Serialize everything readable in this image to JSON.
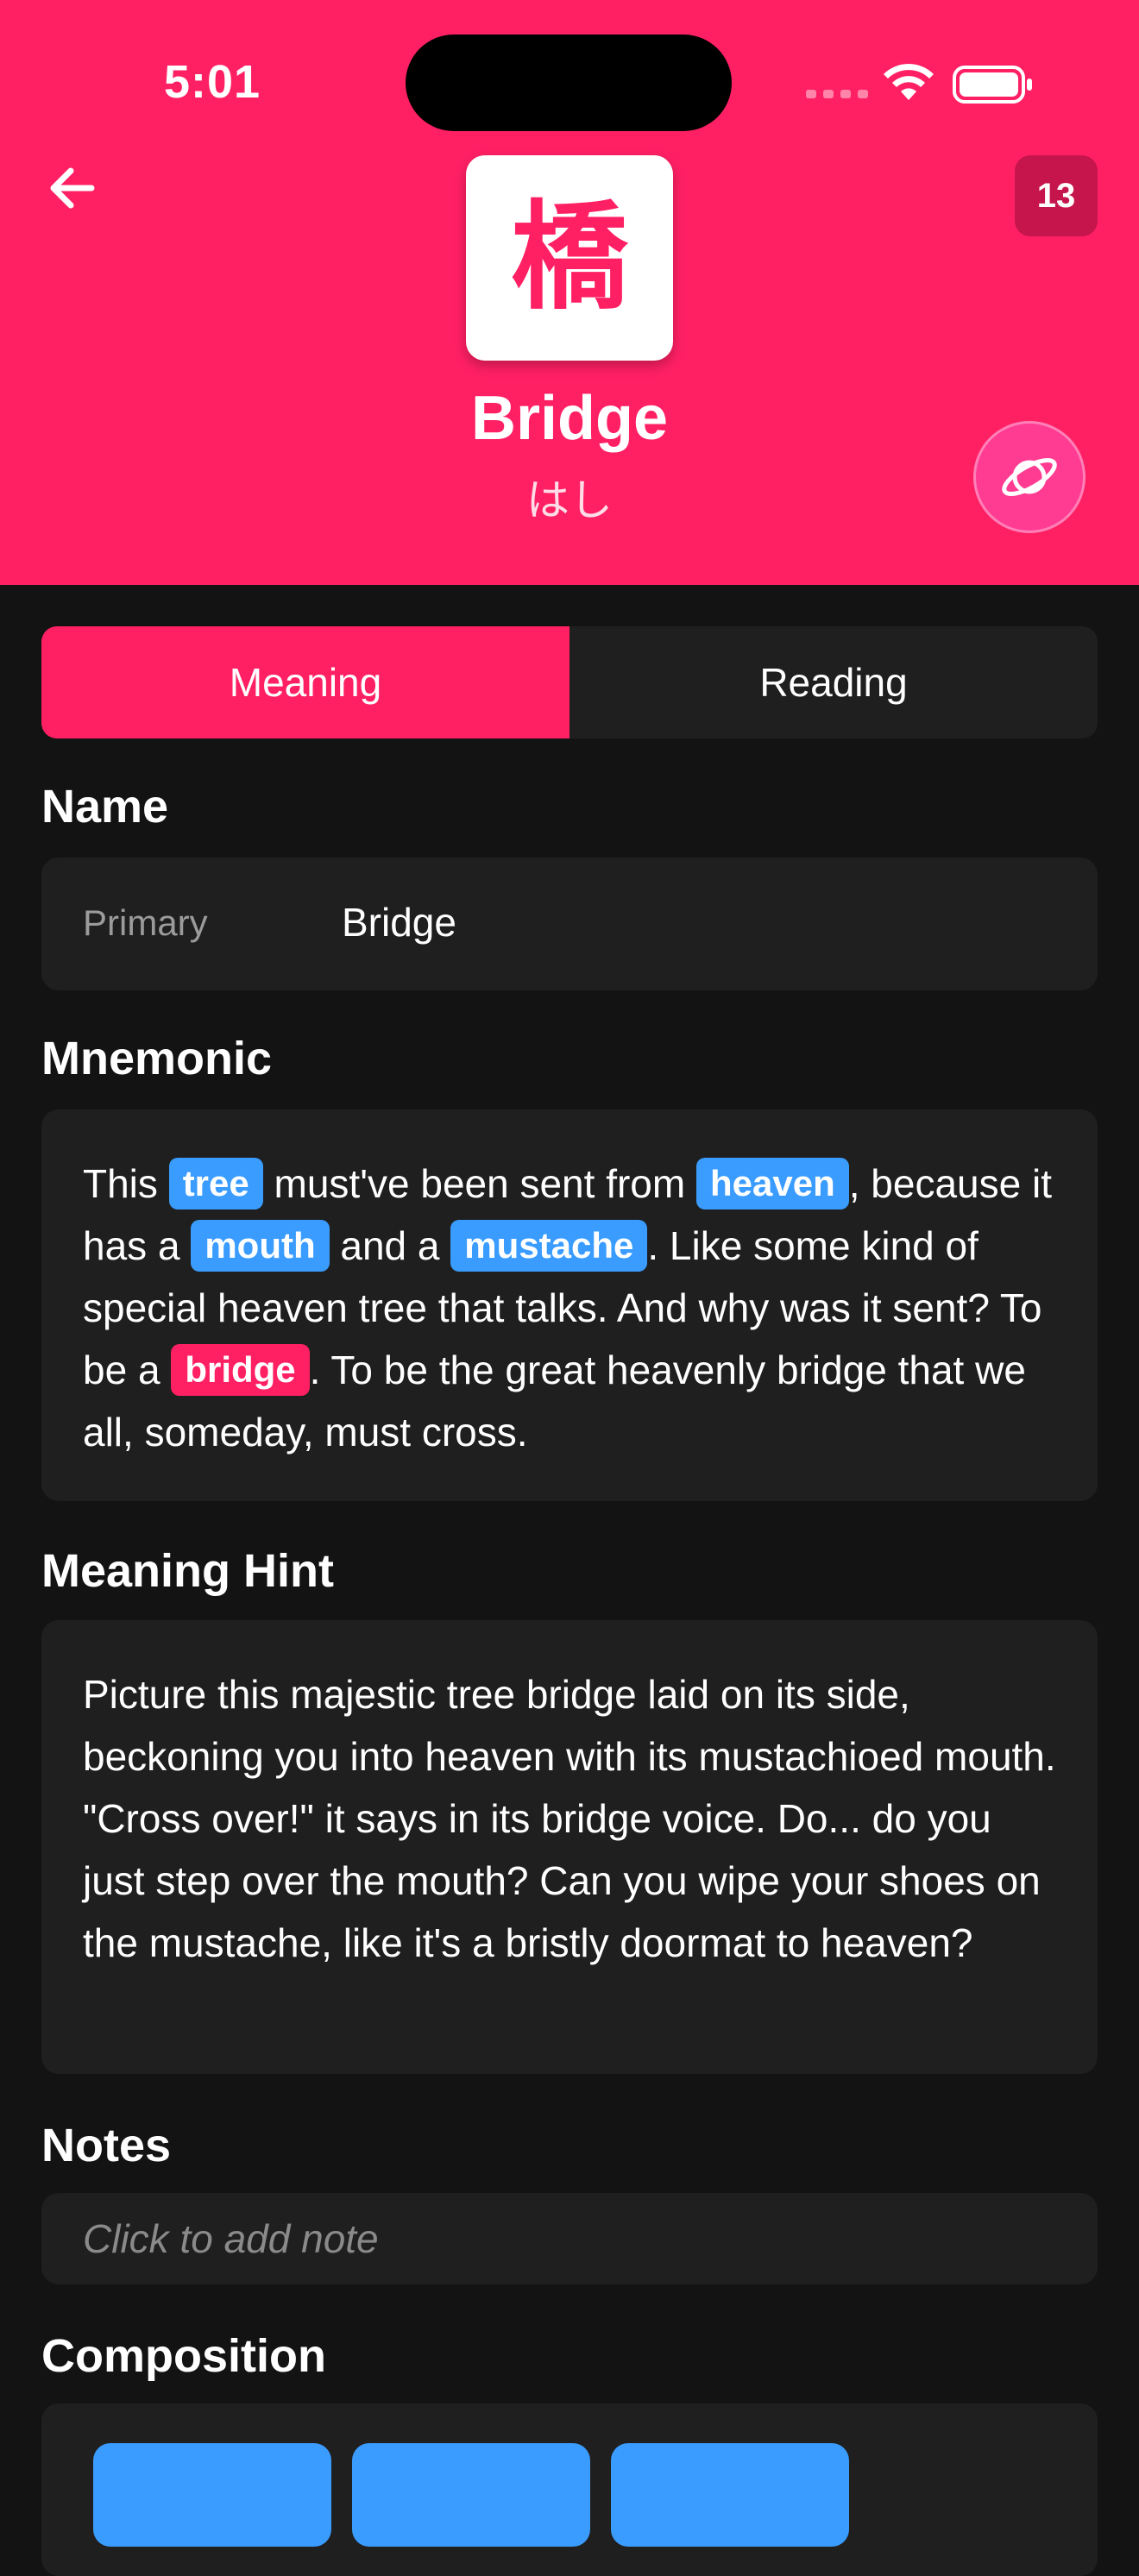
{
  "status_bar": {
    "time": "5:01"
  },
  "header": {
    "level": "13",
    "kanji": "橋",
    "meaning": "Bridge",
    "reading": "はし"
  },
  "tabs": [
    {
      "label": "Meaning",
      "active": true
    },
    {
      "label": "Reading",
      "active": false
    }
  ],
  "name_section": {
    "title": "Name",
    "key": "Primary",
    "value": "Bridge"
  },
  "mnemonic": {
    "title": "Mnemonic",
    "segments": [
      {
        "text": "This "
      },
      {
        "chip": "tree",
        "kind": "radical"
      },
      {
        "text": " must've been sent from "
      },
      {
        "chip": "heaven",
        "kind": "radical"
      },
      {
        "text": ", because it has a "
      },
      {
        "chip": "mouth",
        "kind": "radical"
      },
      {
        "text": " and a "
      },
      {
        "chip": "mustache",
        "kind": "radical"
      },
      {
        "text": ". Like some kind of special heaven tree that talks. And why was it sent? To be a "
      },
      {
        "chip": "bridge",
        "kind": "kanji"
      },
      {
        "text": ". To be the great heavenly bridge that we all, someday, must cross."
      }
    ]
  },
  "meaning_hint": {
    "title": "Meaning Hint",
    "text": "Picture this majestic tree bridge laid on its side, beckoning you into heaven with its mustachioed mouth. \"Cross over!\" it says in its bridge voice. Do... do you just step over the mouth? Can you wipe your shoes on the mustache, like it's a bristly doormat to heaven?"
  },
  "notes": {
    "title": "Notes",
    "placeholder": "Click to add note"
  },
  "composition": {
    "title": "Composition"
  },
  "colors": {
    "accent": "#ff2064",
    "radical_chip": "#3a9cff",
    "background": "#131313",
    "card": "#1f1f1f"
  }
}
